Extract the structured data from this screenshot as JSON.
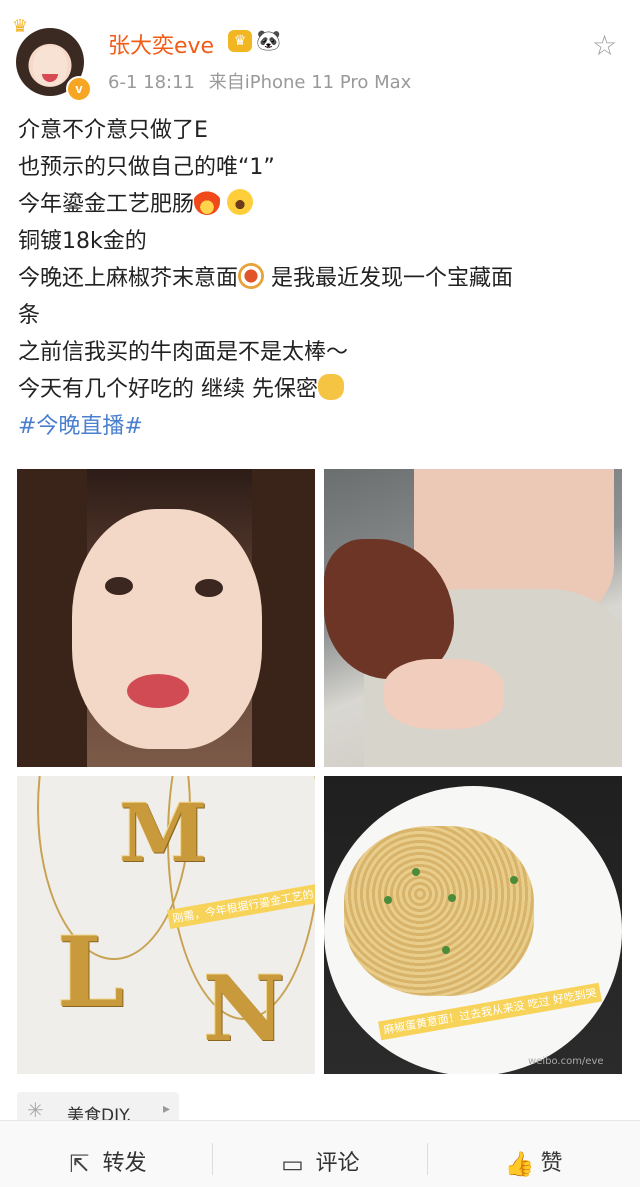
{
  "post": {
    "author": "张大奕eve",
    "date": "6-1 18:11",
    "source": "来自iPhone 11 Pro Max",
    "lines": [
      "介意不介意只做了E",
      "也预示的只做自己的唯“1”",
      "今年鎏金工艺肥肠",
      "铜镀18k金的",
      "今晚还上麻椒芥末意面",
      "是我最近发现一个宝藏面",
      "条",
      "之前信我买的牛肉面是不是太棒～",
      "今天有几个好吃的 继续 先保密"
    ],
    "hashtag": "#今晚直播#",
    "image_stickers": {
      "jewelry": "刚需，今年根据行鎏金工艺的 闪瞎你工艺！",
      "pasta": "麻椒蛋黄意面！过去我从来没 吃过 好吃到哭"
    },
    "watermark": "weibo.com/eve"
  },
  "topic": {
    "label": "美食DIY.",
    "icon": "grid-dots-icon"
  },
  "actions": {
    "repost": "转发",
    "comment": "评论",
    "like": "赞"
  },
  "colors": {
    "name": "#f25c16",
    "hashtag": "#4a7fd0",
    "meta": "#999999"
  }
}
